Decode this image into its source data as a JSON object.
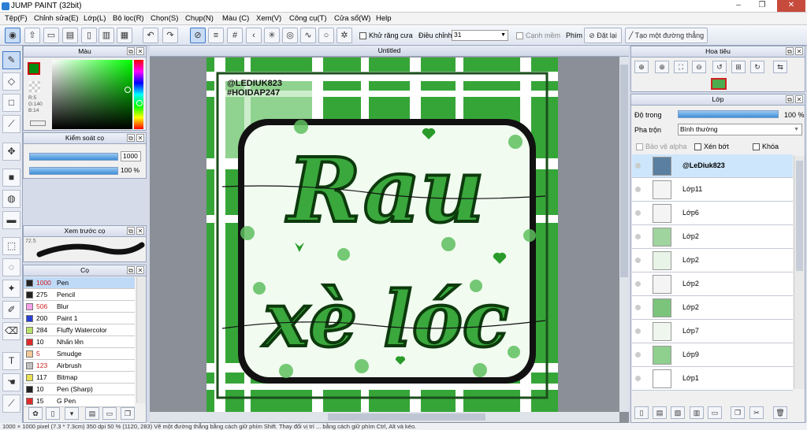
{
  "window": {
    "title": "JUMP PAINT (32bit)",
    "minimize": "–",
    "restore": "❐",
    "close": "✕"
  },
  "menu": [
    "Tệp(F)",
    "Chỉnh sửa(E)",
    "Lớp(L)",
    "Bộ lọc(R)",
    "Chọn(S)",
    "Chụp(N)",
    "Màu (C)",
    "Xem(V)",
    "Công cụ(T)",
    "Cửa sổ(W)",
    "Help"
  ],
  "toolbar": {
    "antialias_label": "Khử răng cưa",
    "adjust_label": "Điều chỉnh",
    "adjust_value": "31",
    "edge_label": "Cạnh mềm",
    "key_label": "Phím",
    "reset_label": "Đặt lại",
    "line_label": "Tạo một đường thẳng"
  },
  "color_panel": {
    "title": "Màu",
    "r": "R:5",
    "g": "G:140",
    "b": "B:14",
    "foreground": "#058c0e"
  },
  "brush_control": {
    "title": "Kiểm soát cọ",
    "size": "1000",
    "opacity": "100 %",
    "size_fill": 1.0,
    "opacity_fill": 1.0
  },
  "brush_preview": {
    "title": "Xem trước cọ",
    "value": "72.5"
  },
  "brush_list": {
    "title": "Cọ",
    "items": [
      {
        "size": "1000",
        "name": "Pen",
        "color": "#222222",
        "selected": true,
        "size_color": "#d02020"
      },
      {
        "size": "275",
        "name": "Pencil",
        "color": "#222222"
      },
      {
        "size": "506",
        "name": "Blur",
        "color": "#f6a0e8",
        "size_color": "#d02020"
      },
      {
        "size": "200",
        "name": "Paint 1",
        "color": "#2a3fd4"
      },
      {
        "size": "284",
        "name": "Fluffy Watercolor",
        "color": "#b8e26a"
      },
      {
        "size": "10",
        "name": "Nhấn lên",
        "color": "#e02a2a"
      },
      {
        "size": "5",
        "name": "Smudge",
        "color": "#f2c89a",
        "size_color": "#d02020"
      },
      {
        "size": "123",
        "name": "Airbrush",
        "color": "#c0c0c0",
        "size_color": "#d02020"
      },
      {
        "size": "117",
        "name": "Bitmap",
        "color": "#e8e050"
      },
      {
        "size": "10",
        "name": "Pen (Sharp)",
        "color": "#222222"
      },
      {
        "size": "15",
        "name": "G Pen",
        "color": "#e02a2a"
      }
    ]
  },
  "document": {
    "tab_title": "Untitled"
  },
  "artwork": {
    "credit1": "@LEDIUK823",
    "credit2": "#HOIDAP247",
    "word1": "Rau",
    "word2": "xè lóc"
  },
  "navigator": {
    "title": "Hoa tiêu"
  },
  "layers": {
    "title": "Lớp",
    "opacity_label": "Độ trong",
    "opacity_value": "100 %",
    "opacity_fill": 1.0,
    "blend_label": "Pha trộn",
    "blend_value": "Bình thường",
    "protect_alpha": "Bảo vệ alpha",
    "clip": "Xén bớt",
    "lock": "Khóa",
    "items": [
      {
        "name": "@LeDiuk823",
        "selected": true,
        "thumb": "#5b7fa0"
      },
      {
        "name": "Lớp11",
        "thumb": "#f4f4f4"
      },
      {
        "name": "Lớp6",
        "thumb": "#f4f4f4"
      },
      {
        "name": "Lớp2",
        "thumb": "#9fd49f"
      },
      {
        "name": "Lớp2",
        "thumb": "#e8f4e8"
      },
      {
        "name": "Lớp2",
        "thumb": "#f4f4f4"
      },
      {
        "name": "Lớp2",
        "thumb": "#7cc47c"
      },
      {
        "name": "Lớp7",
        "thumb": "#eef6ee"
      },
      {
        "name": "Lớp9",
        "thumb": "#8fd08f"
      },
      {
        "name": "Lớp1",
        "thumb": "#ffffff"
      }
    ]
  },
  "status": "1000 × 1000 pixel   (7.3 * 7.3cm)   350 dpi   50 %   (1120, 283)   Vẽ một đường thẳng bằng cách giữ phím Shift. Thay đổi vị trí ... bằng cách giữ phím Ctrl, Alt và kéo."
}
